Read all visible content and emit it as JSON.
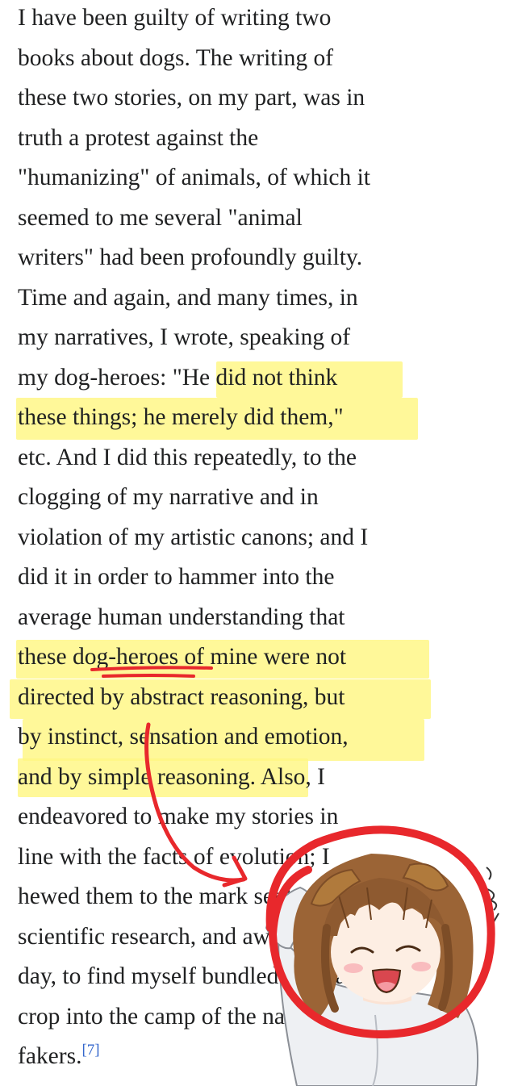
{
  "lines": [
    "I have been guilty of writing two",
    "books about dogs. The writing of",
    "these two stories, on my part, was in",
    "truth a protest against the",
    "\"humanizing\" of animals, of which it",
    "seemed to me several \"animal",
    "writers\" had been profoundly guilty.",
    "Time and again, and many times, in",
    "my narratives, I wrote, speaking of",
    "my dog-heroes: \"He did not think",
    "these things; he merely did them,\"",
    "etc. And I did this repeatedly, to the",
    "clogging of my narrative and in",
    "violation of my artistic canons; and I",
    "did it in order to hammer into the",
    "average human understanding that",
    "these dog-heroes of mine were not",
    "directed by abstract reasoning, but",
    "by instinct, sensation and emotion,",
    "and by simple reasoning. Also, I",
    "endeavored to make my stories in",
    "line with the facts of evolution; I",
    "hewed them to the mark set by",
    "scientific research, and awoke, one",
    "day, to find myself bundled neck and",
    "crop into the camp of the nature-",
    "fakers."
  ],
  "citation": "[7]",
  "highlighted_passages": [
    "He did not think these things; he merely did them,\"",
    "these dog-heroes of mine were not directed by abstract reasoning, but by instinct, sensation and emotion, and by simple reasoning."
  ],
  "annotations": {
    "underlined_phrase": "dog-heroes",
    "sticker": "dog-ear-girl-sticker",
    "circle": "red-hand-drawn-circle",
    "arrow": "red-hand-drawn-arrow"
  },
  "colors": {
    "text": "#202122",
    "highlight": "#fff682",
    "ink": "#e8282c",
    "citation_link": "#3366cc",
    "hair": "#9b6436",
    "dog_ears": "#b07a3c"
  }
}
